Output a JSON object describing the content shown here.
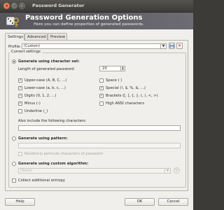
{
  "window": {
    "title": "Password Generator"
  },
  "header": {
    "title": "Password Generation Options",
    "subtitle": "Here you can define properties of generated passwords."
  },
  "tabs": [
    {
      "label": "Settings",
      "active": true
    },
    {
      "label": "Advanced",
      "active": false
    },
    {
      "label": "Preview",
      "active": false
    }
  ],
  "profile": {
    "label": "Profile:",
    "value": "(Custom)"
  },
  "current_settings": {
    "title": "Current settings",
    "charset": {
      "label": "Generate using character set:",
      "selected": true,
      "length_label": "Length of generated password:",
      "length_value": "20",
      "options": [
        {
          "label": "Upper-case (A, B, C, ...)",
          "checked": true
        },
        {
          "label": "Space ( )",
          "checked": false
        },
        {
          "label": "Lower-case (a, b, c, ...)",
          "checked": true
        },
        {
          "label": "Special (!, $, %, &, ...)",
          "checked": true
        },
        {
          "label": "Digits (0, 1, 2, ...)",
          "checked": true
        },
        {
          "label": "Brackets ([, ], {, }, (, ), <, >)",
          "checked": true
        },
        {
          "label": "Minus (-)",
          "checked": true
        },
        {
          "label": "High ANSI characters",
          "checked": false
        },
        {
          "label": "Underline (_)",
          "checked": false
        }
      ],
      "also_include_label": "Also include the following characters:",
      "also_include_value": ""
    },
    "pattern": {
      "label": "Generate using pattern:",
      "selected": false,
      "value": "",
      "permute_label": "Randomly permute characters of password",
      "permute_checked": false
    },
    "algorithm": {
      "label": "Generate using custom algorithm:",
      "selected": false,
      "value": "(None)"
    },
    "entropy": {
      "label": "Collect additional entropy",
      "checked": false
    }
  },
  "footer": {
    "help": "Help",
    "ok": "OK",
    "cancel": "Cancel"
  },
  "icons": {
    "close": "close-icon",
    "minimize": "minimize-icon",
    "maximize": "maximize-icon",
    "header": "dice-key-icon",
    "save": "save-icon",
    "delete": "delete-icon",
    "algorithm_options": "options-icon"
  },
  "colors": {
    "accent_close": "#e0541f",
    "header_bg": "#57565c"
  }
}
